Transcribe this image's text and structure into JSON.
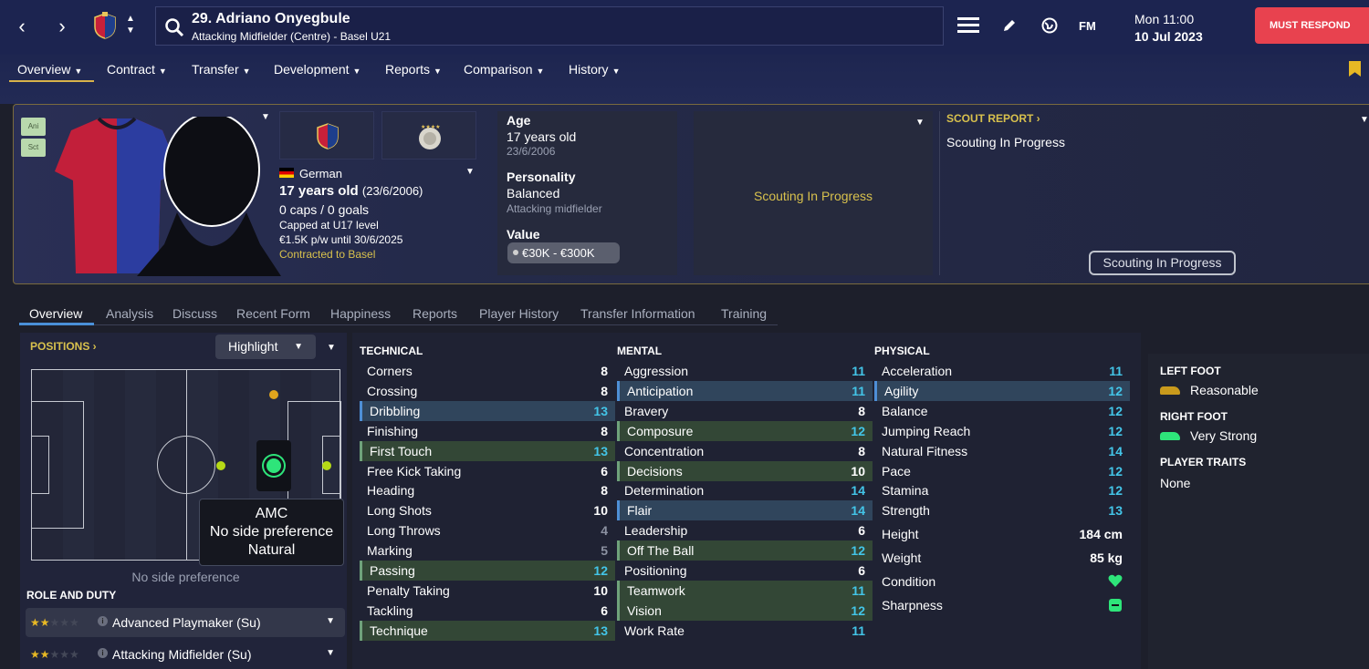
{
  "topbar": {
    "player_name": "29. Adriano Onyegbule",
    "player_subtitle": "Attacking Midfielder (Centre) - Basel U21",
    "date_line1": "Mon 11:00",
    "date_line2": "10 Jul 2023",
    "must_respond": "MUST RESPOND",
    "fm_label": "FM"
  },
  "menu": [
    "Overview",
    "Contract",
    "Transfer",
    "Development",
    "Reports",
    "Comparison",
    "History"
  ],
  "badges": [
    "Ani",
    "Sct"
  ],
  "hero": {
    "nationality": "German",
    "age_line": "17 years old",
    "dob_paren": "(23/6/2006)",
    "caps": "0 caps / 0 goals",
    "capped": "Capped at U17 level",
    "wage": "€1.5K p/w until 30/6/2025",
    "contracted": "Contracted to Basel",
    "age_label": "Age",
    "age_value": "17 years old",
    "age_dob": "23/6/2006",
    "personality_label": "Personality",
    "personality_value": "Balanced",
    "personality_sub": "Attacking midfielder",
    "value_label": "Value",
    "value_range": "€30K - €300K",
    "scouting_center": "Scouting In Progress",
    "scout_report_label": "SCOUT REPORT",
    "scout_report_text": "Scouting In Progress",
    "scout_button": "Scouting In Progress"
  },
  "tabs": [
    "Overview",
    "Analysis",
    "Discuss",
    "Recent Form",
    "Happiness",
    "Reports",
    "Player History",
    "Transfer Information",
    "Training"
  ],
  "positions": {
    "label": "POSITIONS",
    "highlight_button": "Highlight",
    "tooltip_pos": "AMC",
    "tooltip_side": "No side preference",
    "tooltip_level": "Natural",
    "side_pref": "No side preference"
  },
  "role_duty": {
    "label": "ROLE AND DUTY",
    "roles": [
      {
        "name": "Advanced Playmaker (Su)",
        "stars": 1.5
      },
      {
        "name": "Attacking Midfielder (Su)",
        "stars": 1.5
      }
    ]
  },
  "technical": {
    "label": "TECHNICAL",
    "rows": [
      {
        "name": "Corners",
        "value": "8",
        "hl": "",
        "color": "white"
      },
      {
        "name": "Crossing",
        "value": "8",
        "hl": "",
        "color": "white"
      },
      {
        "name": "Dribbling",
        "value": "13",
        "hl": "blue",
        "color": "blue"
      },
      {
        "name": "Finishing",
        "value": "8",
        "hl": "",
        "color": "white"
      },
      {
        "name": "First Touch",
        "value": "13",
        "hl": "green",
        "color": "blue"
      },
      {
        "name": "Free Kick Taking",
        "value": "6",
        "hl": "",
        "color": "white"
      },
      {
        "name": "Heading",
        "value": "8",
        "hl": "",
        "color": "white"
      },
      {
        "name": "Long Shots",
        "value": "10",
        "hl": "",
        "color": "white"
      },
      {
        "name": "Long Throws",
        "value": "4",
        "hl": "",
        "color": "grey"
      },
      {
        "name": "Marking",
        "value": "5",
        "hl": "",
        "color": "grey"
      },
      {
        "name": "Passing",
        "value": "12",
        "hl": "green",
        "color": "blue"
      },
      {
        "name": "Penalty Taking",
        "value": "10",
        "hl": "",
        "color": "white"
      },
      {
        "name": "Tackling",
        "value": "6",
        "hl": "",
        "color": "white"
      },
      {
        "name": "Technique",
        "value": "13",
        "hl": "green",
        "color": "blue"
      }
    ]
  },
  "mental": {
    "label": "MENTAL",
    "rows": [
      {
        "name": "Aggression",
        "value": "11",
        "hl": "",
        "color": "blue"
      },
      {
        "name": "Anticipation",
        "value": "11",
        "hl": "blue",
        "color": "blue"
      },
      {
        "name": "Bravery",
        "value": "8",
        "hl": "",
        "color": "white"
      },
      {
        "name": "Composure",
        "value": "12",
        "hl": "green",
        "color": "blue"
      },
      {
        "name": "Concentration",
        "value": "8",
        "hl": "",
        "color": "white"
      },
      {
        "name": "Decisions",
        "value": "10",
        "hl": "green",
        "color": "white"
      },
      {
        "name": "Determination",
        "value": "14",
        "hl": "",
        "color": "blue"
      },
      {
        "name": "Flair",
        "value": "14",
        "hl": "blue",
        "color": "blue"
      },
      {
        "name": "Leadership",
        "value": "6",
        "hl": "",
        "color": "white"
      },
      {
        "name": "Off The Ball",
        "value": "12",
        "hl": "green",
        "color": "blue"
      },
      {
        "name": "Positioning",
        "value": "6",
        "hl": "",
        "color": "white"
      },
      {
        "name": "Teamwork",
        "value": "11",
        "hl": "green",
        "color": "blue"
      },
      {
        "name": "Vision",
        "value": "12",
        "hl": "green",
        "color": "blue"
      },
      {
        "name": "Work Rate",
        "value": "11",
        "hl": "",
        "color": "blue"
      }
    ]
  },
  "physical": {
    "label": "PHYSICAL",
    "rows": [
      {
        "name": "Acceleration",
        "value": "11",
        "hl": "",
        "color": "blue"
      },
      {
        "name": "Agility",
        "value": "12",
        "hl": "blue",
        "color": "blue"
      },
      {
        "name": "Balance",
        "value": "12",
        "hl": "",
        "color": "blue"
      },
      {
        "name": "Jumping Reach",
        "value": "12",
        "hl": "",
        "color": "blue"
      },
      {
        "name": "Natural Fitness",
        "value": "14",
        "hl": "",
        "color": "blue"
      },
      {
        "name": "Pace",
        "value": "12",
        "hl": "",
        "color": "blue"
      },
      {
        "name": "Stamina",
        "value": "12",
        "hl": "",
        "color": "blue"
      },
      {
        "name": "Strength",
        "value": "13",
        "hl": "",
        "color": "blue"
      }
    ],
    "height_label": "Height",
    "height_value": "184 cm",
    "weight_label": "Weight",
    "weight_value": "85 kg",
    "condition_label": "Condition",
    "sharpness_label": "Sharpness"
  },
  "feet": {
    "left_label": "LEFT FOOT",
    "left_value": "Reasonable",
    "right_label": "RIGHT FOOT",
    "right_value": "Very Strong",
    "traits_label": "PLAYER TRAITS",
    "traits_value": "None"
  },
  "colors": {
    "accent_blue": "#43c5e8",
    "must_respond": "#e8424f",
    "gold": "#d8c14d",
    "green_good": "#2ee57a"
  }
}
